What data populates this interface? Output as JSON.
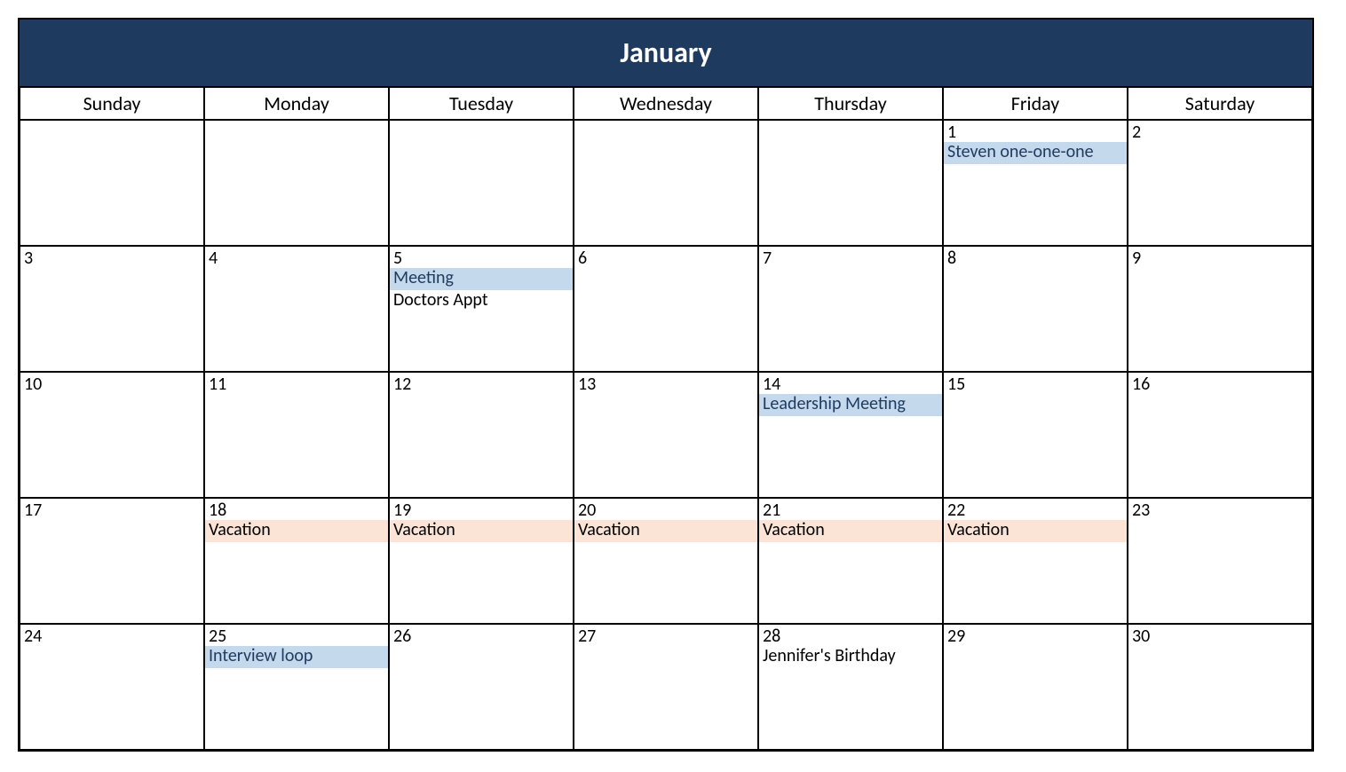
{
  "title": "January",
  "weekdays": [
    "Sunday",
    "Monday",
    "Tuesday",
    "Wednesday",
    "Thursday",
    "Friday",
    "Saturday"
  ],
  "colors": {
    "blue": "#c5d9ed",
    "peach": "#fbe4d5",
    "header": "#1f3a5f"
  },
  "weeks": [
    [
      {
        "day": ""
      },
      {
        "day": ""
      },
      {
        "day": ""
      },
      {
        "day": ""
      },
      {
        "day": ""
      },
      {
        "day": "1",
        "events": [
          {
            "label": "Steven one-one-one",
            "color": "blue"
          }
        ]
      },
      {
        "day": "2"
      }
    ],
    [
      {
        "day": "3"
      },
      {
        "day": "4"
      },
      {
        "day": "5",
        "events": [
          {
            "label": "Meeting",
            "color": "blue"
          },
          {
            "label": "Doctors Appt",
            "color": "plain"
          }
        ]
      },
      {
        "day": "6"
      },
      {
        "day": "7"
      },
      {
        "day": "8"
      },
      {
        "day": "9"
      }
    ],
    [
      {
        "day": "10"
      },
      {
        "day": "11"
      },
      {
        "day": "12"
      },
      {
        "day": "13"
      },
      {
        "day": "14",
        "events": [
          {
            "label": "Leadership Meeting",
            "color": "blue"
          }
        ]
      },
      {
        "day": "15"
      },
      {
        "day": "16"
      }
    ],
    [
      {
        "day": "17"
      },
      {
        "day": "18",
        "events": [
          {
            "label": "Vacation",
            "color": "peach"
          }
        ]
      },
      {
        "day": "19",
        "events": [
          {
            "label": "Vacation",
            "color": "peach"
          }
        ]
      },
      {
        "day": "20",
        "events": [
          {
            "label": "Vacation",
            "color": "peach"
          }
        ]
      },
      {
        "day": "21",
        "events": [
          {
            "label": "Vacation",
            "color": "peach"
          }
        ]
      },
      {
        "day": "22",
        "events": [
          {
            "label": "Vacation",
            "color": "peach"
          }
        ]
      },
      {
        "day": "23"
      }
    ],
    [
      {
        "day": "24"
      },
      {
        "day": "25",
        "events": [
          {
            "label": "Interview loop",
            "color": "blue"
          }
        ]
      },
      {
        "day": "26"
      },
      {
        "day": "27"
      },
      {
        "day": "28",
        "events": [
          {
            "label": "Jennifer's Birthday",
            "color": "plain"
          }
        ]
      },
      {
        "day": "29"
      },
      {
        "day": "30"
      }
    ]
  ]
}
